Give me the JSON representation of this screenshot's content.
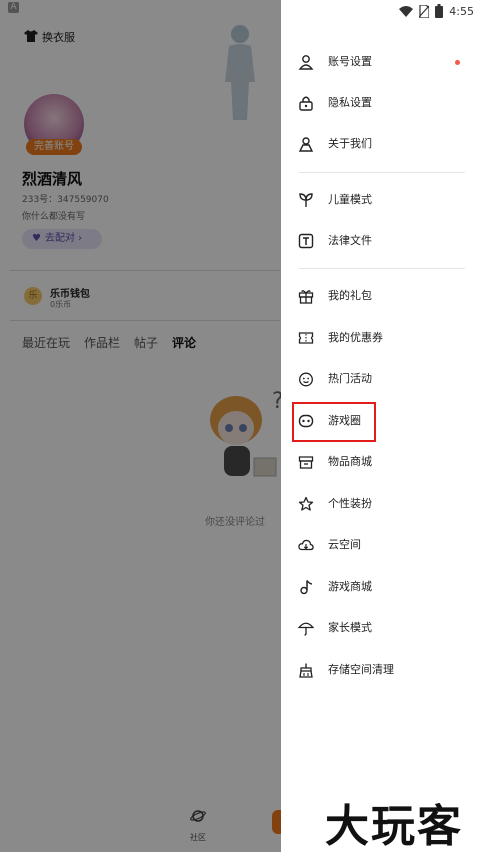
{
  "background_page": {
    "shortcut_badge": "A",
    "change_clothes": "换衣服",
    "complete_account_badge": "完善账号",
    "username": "烈酒清风",
    "uid": "233号：347559070",
    "bio": "你什么都没有写",
    "match_button": "去配对",
    "wallet_title": "乐币钱包",
    "wallet_balance": "0乐币",
    "coin_glyph": "乐",
    "tabs": [
      "最近在玩",
      "作品栏",
      "帖子",
      "评论"
    ],
    "active_tab": "评论",
    "empty_text": "你还没评论过",
    "bottom_nav_community": "社区"
  },
  "status_bar": {
    "time": "4:55"
  },
  "drawer": {
    "items": [
      {
        "label": "账号设置",
        "icon": "person-icon",
        "badge_dot": true
      },
      {
        "label": "隐私设置",
        "icon": "lock-icon"
      },
      {
        "label": "关于我们",
        "icon": "about-icon"
      },
      {
        "label": "儿童模式",
        "icon": "sprout-icon"
      },
      {
        "label": "法律文件",
        "icon": "legal-doc-icon"
      },
      {
        "label": "我的礼包",
        "icon": "gift-icon"
      },
      {
        "label": "我的优惠券",
        "icon": "coupon-icon"
      },
      {
        "label": "热门活动",
        "icon": "smiley-icon"
      },
      {
        "label": "游戏圈",
        "icon": "game-circle-icon",
        "highlighted": true
      },
      {
        "label": "物品商城",
        "icon": "shop-icon"
      },
      {
        "label": "个性装扮",
        "icon": "star-icon"
      },
      {
        "label": "云空间",
        "icon": "cloud-icon"
      },
      {
        "label": "游戏商城",
        "icon": "music-note-icon"
      },
      {
        "label": "家长模式",
        "icon": "umbrella-icon"
      },
      {
        "label": "存储空间清理",
        "icon": "broom-icon"
      }
    ],
    "highlight_color": "#e21b1b",
    "badge_color": "#f05a4a"
  },
  "watermark": "大玩客"
}
